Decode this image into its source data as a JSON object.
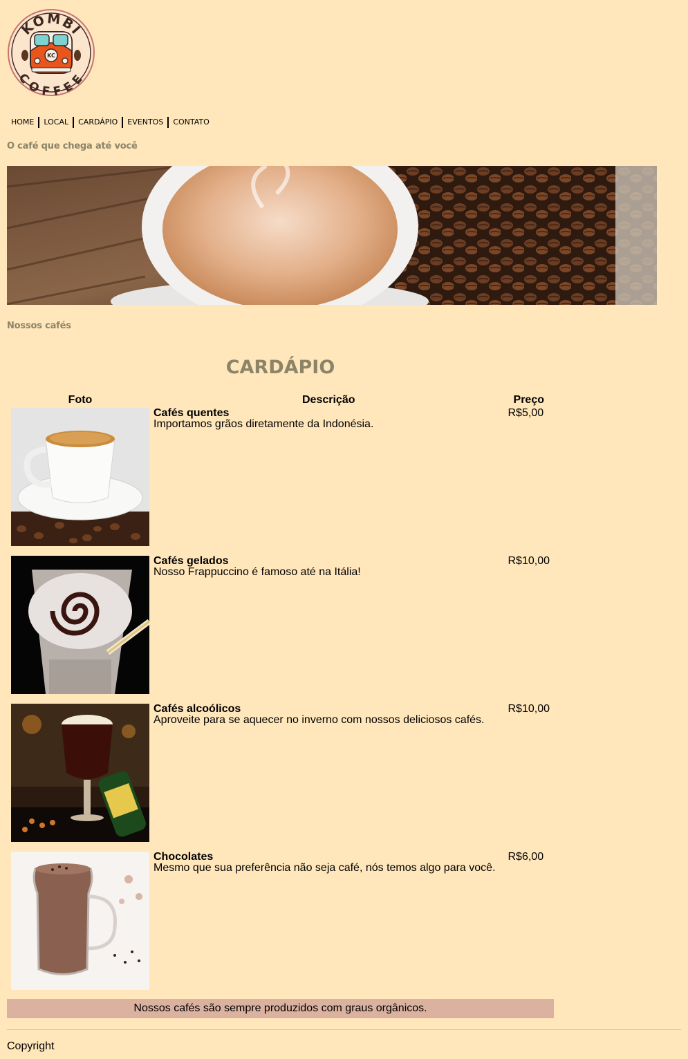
{
  "brand": {
    "logo_top": "KOMBI",
    "logo_bottom": "COFFEE",
    "logo_badge": "KC"
  },
  "nav": [
    "HOME",
    "LOCAL",
    "CARDÁPIO",
    "EVENTOS",
    "CONTATO"
  ],
  "tagline": "O café que chega até você",
  "section_label": "Nossos cafés",
  "menu": {
    "title": "CARDÁPIO",
    "headers": {
      "photo": "Foto",
      "description": "Descrição",
      "price": "Preço"
    },
    "items": [
      {
        "name": "Cafés quentes",
        "description": "Importamos grãos diretamente da Indonésia.",
        "price": "R$5,00"
      },
      {
        "name": "Cafés gelados",
        "description": "Nosso Frappuccino é famoso até na Itália!",
        "price": "R$10,00"
      },
      {
        "name": "Cafés alcoólicos",
        "description": "Aproveite para se aquecer no inverno com nossos deliciosos cafés.",
        "price": "R$10,00"
      },
      {
        "name": "Chocolates",
        "description": "Mesmo que sua preferência não seja café, nós temos algo para você.",
        "price": "R$6,00"
      }
    ]
  },
  "note": "Nossos cafés são sempre produzidos com graus orgânicos.",
  "footer": {
    "copyright": "Copyright"
  },
  "colors": {
    "background": "#ffe6bb",
    "heading": "#8b8468",
    "note_bg": "#dbb19f",
    "logo_orange": "#e8561e",
    "logo_teal": "#7dd3cf"
  }
}
